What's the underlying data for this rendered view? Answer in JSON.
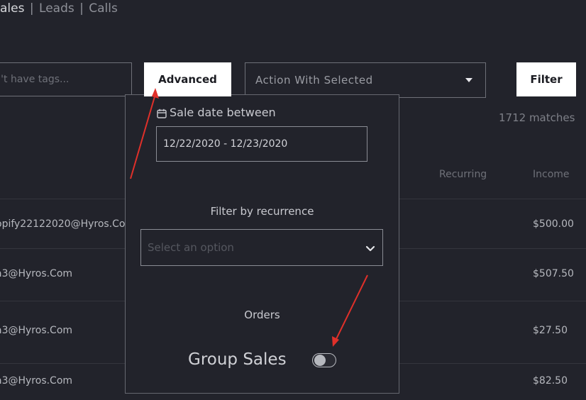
{
  "nav": {
    "items": [
      "ales",
      "Leads",
      "Calls"
    ],
    "separator": "|"
  },
  "toolbar": {
    "tags_placeholder": "sn't have tags...",
    "advanced_label": "Advanced",
    "action_select_value": "Action With Selected",
    "filter_label": "Filter"
  },
  "matches_text": "1712 matches",
  "table": {
    "headers": {
      "recurring": "Recurring",
      "income": "Income"
    },
    "rows": [
      {
        "email": "opify22122020@Hyros.Co",
        "income": "$500.00"
      },
      {
        "email": "a3@Hyros.Com",
        "income": "$507.50"
      },
      {
        "email": "a3@Hyros.Com",
        "income": "$27.50"
      },
      {
        "email": "a3@Hyros.Com",
        "income": "$82.50"
      }
    ]
  },
  "advanced_panel": {
    "sale_date_label": "Sale date between",
    "date_range_value": "12/22/2020 - 12/23/2020",
    "recurrence_label": "Filter by recurrence",
    "recurrence_placeholder": "Select an option",
    "orders_label": "Orders",
    "group_sales_label": "Group Sales",
    "group_sales_enabled": false
  },
  "colors": {
    "background": "#22232b",
    "annotation_arrow": "#e0302a",
    "button_bg": "#ffffff"
  },
  "icons": [
    "calendar-icon",
    "chevron-down-icon",
    "caret-down-icon"
  ]
}
